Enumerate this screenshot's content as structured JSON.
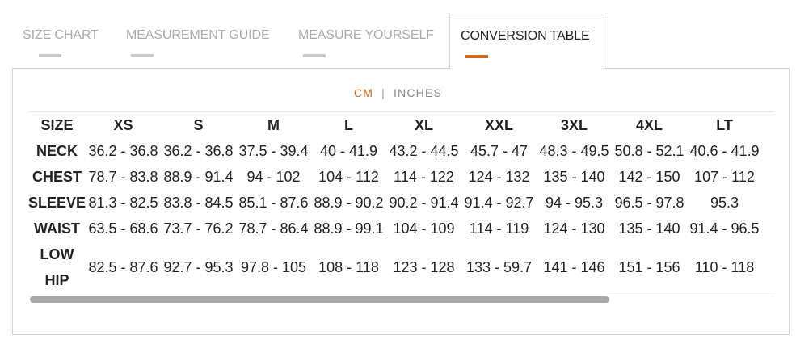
{
  "tabs": [
    {
      "label": "SIZE CHART"
    },
    {
      "label": "MEASUREMENT GUIDE"
    },
    {
      "label": "MEASURE YOURSELF"
    },
    {
      "label": "CONVERSION TABLE"
    }
  ],
  "units": {
    "cm": "CM",
    "separator": "|",
    "inches": "INCHES",
    "selected": "CM"
  },
  "colors": {
    "accent": "#d26a1c",
    "inactive_bar": "#c8c8c8",
    "border": "#d4d4d4"
  },
  "table": {
    "header": [
      "SIZE",
      "XS",
      "S",
      "M",
      "L",
      "XL",
      "XXL",
      "3XL",
      "4XL",
      "LT"
    ],
    "rows": [
      {
        "label": "NECK",
        "cells": [
          "36.2 - 36.8",
          "36.2 - 36.8",
          "37.5 - 39.4",
          "40 - 41.9",
          "43.2 - 44.5",
          "45.7 - 47",
          "48.3 - 49.5",
          "50.8 - 52.1",
          "40.6 - 41.9"
        ]
      },
      {
        "label": "CHEST",
        "cells": [
          "78.7 - 83.8",
          "88.9 - 91.4",
          "94 - 102",
          "104 - 112",
          "114 - 122",
          "124 - 132",
          "135 - 140",
          "142 - 150",
          "107 - 112"
        ]
      },
      {
        "label": "SLEEVE",
        "cells": [
          "81.3 - 82.5",
          "83.8 - 84.5",
          "85.1 - 87.6",
          "88.9 - 90.2",
          "90.2 - 91.4",
          "91.4 - 92.7",
          "94 - 95.3",
          "96.5 - 97.8",
          "95.3"
        ]
      },
      {
        "label": "WAIST",
        "cells": [
          "63.5 - 68.6",
          "73.7 - 76.2",
          "78.7 - 86.4",
          "88.9 - 99.1",
          "104 - 109",
          "114 - 119",
          "124 - 130",
          "135 - 140",
          "91.4 - 96.5"
        ]
      },
      {
        "label_line1": "LOW",
        "label_line2": "HIP",
        "cells": [
          "82.5 - 87.6",
          "92.7 - 95.3",
          "97.8 - 105",
          "108 - 118",
          "123 - 128",
          "133 - 59.7",
          "141 - 146",
          "151 - 156",
          "110 - 118"
        ]
      }
    ]
  }
}
